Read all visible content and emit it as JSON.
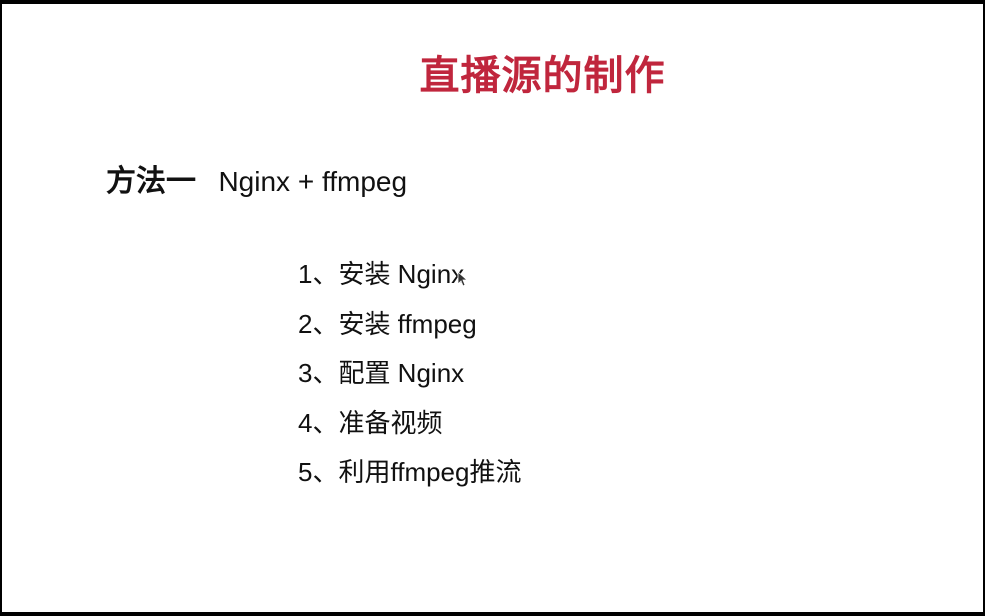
{
  "slide": {
    "title": "直播源的制作",
    "method": {
      "label": "方法一",
      "description": "Nginx + ffmpeg"
    },
    "steps": [
      "1、安装 Nginx",
      "2、安装 ffmpeg",
      "3、配置 Nginx",
      "4、准备视频",
      "5、利用ffmpeg推流"
    ]
  },
  "colors": {
    "title": "#c0263d",
    "text": "#111111",
    "background": "#ffffff",
    "frame": "#000000"
  },
  "icons": {
    "cursor": "mouse-pointer-icon"
  }
}
